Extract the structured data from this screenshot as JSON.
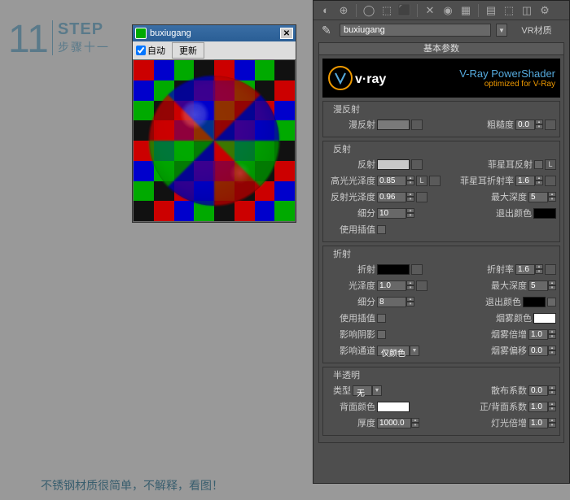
{
  "step": {
    "num": "11",
    "en": "STEP",
    "cn": "步骤十一"
  },
  "caption": "不锈钢材质很简单，不解释，看图！",
  "preview": {
    "title": "buxiugang",
    "auto": "自动",
    "update": "更新"
  },
  "toolbar": {
    "icons": [
      "◐",
      "⊕",
      "◯",
      "⬚",
      "⬛",
      "✕",
      "◉",
      "▦",
      "▤",
      "⬚",
      "◫",
      "⚙"
    ]
  },
  "matname": {
    "name": "buxiugang",
    "type": "VR材质"
  },
  "rollhead": "基本参数",
  "banner": {
    "l1": "V-Ray PowerShader",
    "l2": "optimized for V-Ray"
  },
  "diffuse": {
    "title": "漫反射",
    "label": "漫反射",
    "rough_lbl": "粗糙度",
    "rough": "0.0"
  },
  "reflect": {
    "title": "反射",
    "label": "反射",
    "hglossy_lbl": "高光光泽度",
    "hglossy": "0.85",
    "rglossy_lbl": "反射光泽度",
    "rglossy": "0.96",
    "subdiv_lbl": "细分",
    "subdiv": "10",
    "useinterp_lbl": "使用插值",
    "fresnel_lbl": "菲星耳反射",
    "fresnelior_lbl": "菲星耳折射率",
    "fresnelior": "1.6",
    "maxdepth_lbl": "最大深度",
    "maxdepth": "5",
    "exitcolor_lbl": "退出颜色",
    "L": "L"
  },
  "refract": {
    "title": "折射",
    "label": "折射",
    "glossy_lbl": "光泽度",
    "glossy": "1.0",
    "subdiv_lbl": "细分",
    "subdiv": "8",
    "useinterp_lbl": "使用插值",
    "affect_lbl": "影响阴影",
    "channel_lbl": "影响通道",
    "channel": "仅颜色",
    "ior_lbl": "折射率",
    "ior": "1.6",
    "maxdepth_lbl": "最大深度",
    "maxdepth": "5",
    "exitcolor_lbl": "退出颜色",
    "fogcolor_lbl": "烟雾颜色",
    "fogmult_lbl": "烟雾倍增",
    "fogmult": "1.0",
    "fogbias_lbl": "烟雾偏移",
    "fogbias": "0.0"
  },
  "trans": {
    "title": "半透明",
    "type_lbl": "类型",
    "type": "无",
    "backcolor_lbl": "背面颜色",
    "thickness_lbl": "厚度",
    "thickness": "1000.0",
    "scatter_lbl": "散布系数",
    "scatter": "0.0",
    "fb_lbl": "正/背面系数",
    "fb": "1.0",
    "lightmult_lbl": "灯光倍增",
    "lightmult": "1.0"
  }
}
